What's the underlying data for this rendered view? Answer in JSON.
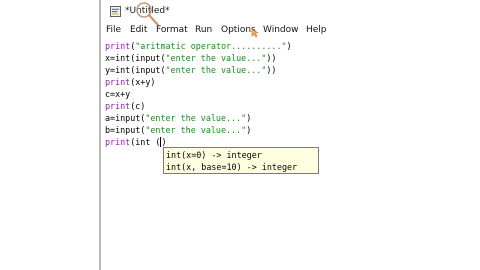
{
  "window": {
    "title": "*Untitled*"
  },
  "menu": [
    "File",
    "Edit",
    "Format",
    "Run",
    "Options",
    "Window",
    "Help"
  ],
  "code": [
    {
      "kw": "print",
      "a": "(",
      "str": "\"aritmatic operator..........\"",
      "b": ")"
    },
    {
      "kw": "",
      "a": "x=int(input(",
      "str": "\"enter the value...\"",
      "b": "))"
    },
    {
      "kw": "",
      "a": "y=int(input(",
      "str": "\"enter the value...\"",
      "b": "))"
    },
    {
      "kw": "print",
      "a": "(x+y)",
      "str": "",
      "b": ""
    },
    {
      "kw": "",
      "a": "c=x+y",
      "str": "",
      "b": ""
    },
    {
      "kw": "print",
      "a": "(c)",
      "str": "",
      "b": ""
    },
    {
      "kw": "",
      "a": "a=input(",
      "str": "\"enter the value...\"",
      "b": ")"
    },
    {
      "kw": "",
      "a": "b=input(",
      "str": "\"enter the value...\"",
      "b": ")"
    }
  ],
  "current_line": {
    "kw": "print",
    "a": "(int (",
    "b": ")"
  },
  "calltip": [
    "int(x=0) -> integer",
    "int(x, base=10) -> integer"
  ],
  "colors": {
    "keyword": "#8c1fb3",
    "string": "#1e8a1e",
    "tooltip_bg": "#ffffe0"
  }
}
